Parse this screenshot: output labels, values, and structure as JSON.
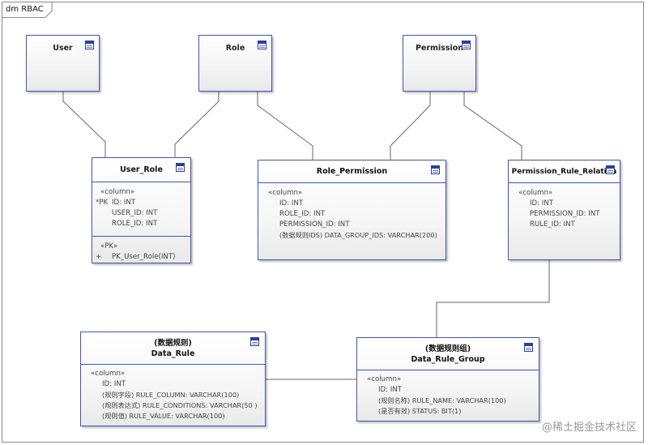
{
  "diagram": {
    "frame_title": "dm RBAC",
    "watermark": "@稀土掘金技术社区"
  },
  "entities": {
    "user": "User",
    "role": "Role",
    "permission": "Permission"
  },
  "tables": {
    "user_role": {
      "name": "User_Role",
      "stereotype": "«column»",
      "pk_marker": "*PK",
      "columns": [
        "ID: INT",
        "USER_ID: INT",
        "ROLE_ID: INT"
      ],
      "op_stereotype": "«PK»",
      "op_marker": "+",
      "operation": "PK_User_Role(INT)"
    },
    "role_permission": {
      "name": "Role_Permission",
      "stereotype": "«column»",
      "columns": [
        "ID: INT",
        "ROLE_ID: INT",
        "PERMISSION_ID: INT",
        "(数据规则IDS) DATA_GROUP_IDS: VARCHAR(200)"
      ]
    },
    "permission_rule_relation": {
      "name": "Permission_Rule_Relation",
      "stereotype": "«column»",
      "columns": [
        "ID: INT",
        "PERMISSION_ID: INT",
        "RULE_ID: INT"
      ]
    },
    "data_rule": {
      "alias": "(数据规则)",
      "name": "Data_Rule",
      "stereotype": "«column»",
      "columns": [
        "ID: INT",
        "(规则字段) RULE_COLUMN: VARCHAR(100)",
        "(规则表达式) RULE_CONDITIONS: VARCHAR(50 )",
        "(规则值) RULE_VALUE: VARCHAR(100)"
      ]
    },
    "data_rule_group": {
      "alias": "(数据规则组)",
      "name": "Data_Rule_Group",
      "stereotype": "«column»",
      "columns": [
        "ID: INT",
        "(规则名称) RULE_NAME: VARCHAR(100)",
        "(是否有效) STATUS: BIT(1)"
      ]
    }
  },
  "colors": {
    "border": "#3f56b8",
    "connector": "#666666"
  },
  "icons": {
    "table": "table-icon"
  }
}
